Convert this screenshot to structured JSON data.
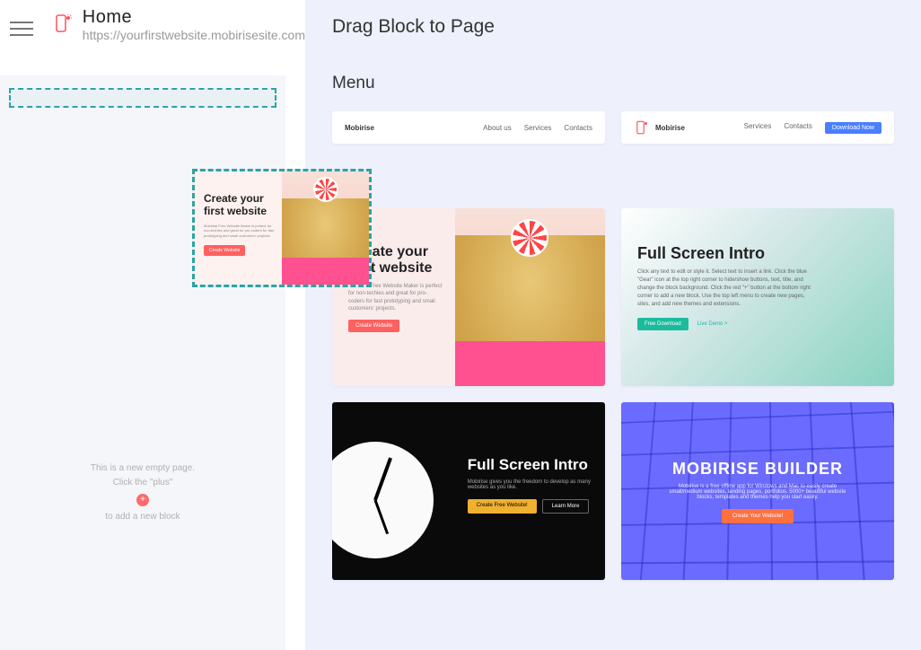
{
  "header": {
    "page_title": "Home",
    "page_url": "https://yourfirstwebsite.mobirisesite.com"
  },
  "canvas": {
    "empty_line1": "This is a new empty page.",
    "empty_line2": "Click the \"plus\"",
    "empty_line3": "to add a new block"
  },
  "panel": {
    "title": "Drag Block to Page",
    "sections": {
      "menu": "Menu"
    }
  },
  "blocks": {
    "menu1": {
      "brand": "Mobirise",
      "nav": [
        "About us",
        "Services",
        "Contacts"
      ]
    },
    "menu2": {
      "brand": "Mobirise",
      "nav": [
        "Services",
        "Contacts"
      ],
      "cta": "Download Now"
    },
    "hero1": {
      "title1": "Create your",
      "title2": "first website",
      "desc": "Mobirise Free Website Maker is perfect for non-techies and great for pro-coders for fast prototyping and small customers' projects.",
      "btn": "Create Website"
    },
    "hero2": {
      "title": "Full Screen Intro",
      "desc": "Click any text to edit or style it. Select text to insert a link. Click the blue \"Gear\" icon at the top right corner to hide/show buttons, text, title, and change the block background. Click the red \"+\" button at the bottom right corner to add a new block. Use the top left menu to create new pages, sites, and add new themes and extensions.",
      "btn1": "Free Download",
      "btn2": "Live Demo >"
    },
    "hero3": {
      "title": "Full Screen Intro",
      "desc": "Mobirise gives you the freedom to develop as many websites as you like.",
      "btn1": "Create Free Website!",
      "btn2": "Learn More"
    },
    "hero4": {
      "title": "MOBIRISE BUILDER",
      "desc": "Mobirise is a free offline app for Windows and Mac to easily create small/medium websites, landing pages, portfolios. 5000+ beautiful website blocks, templates and themes help you start easily.",
      "btn": "Create Your Website!"
    }
  }
}
